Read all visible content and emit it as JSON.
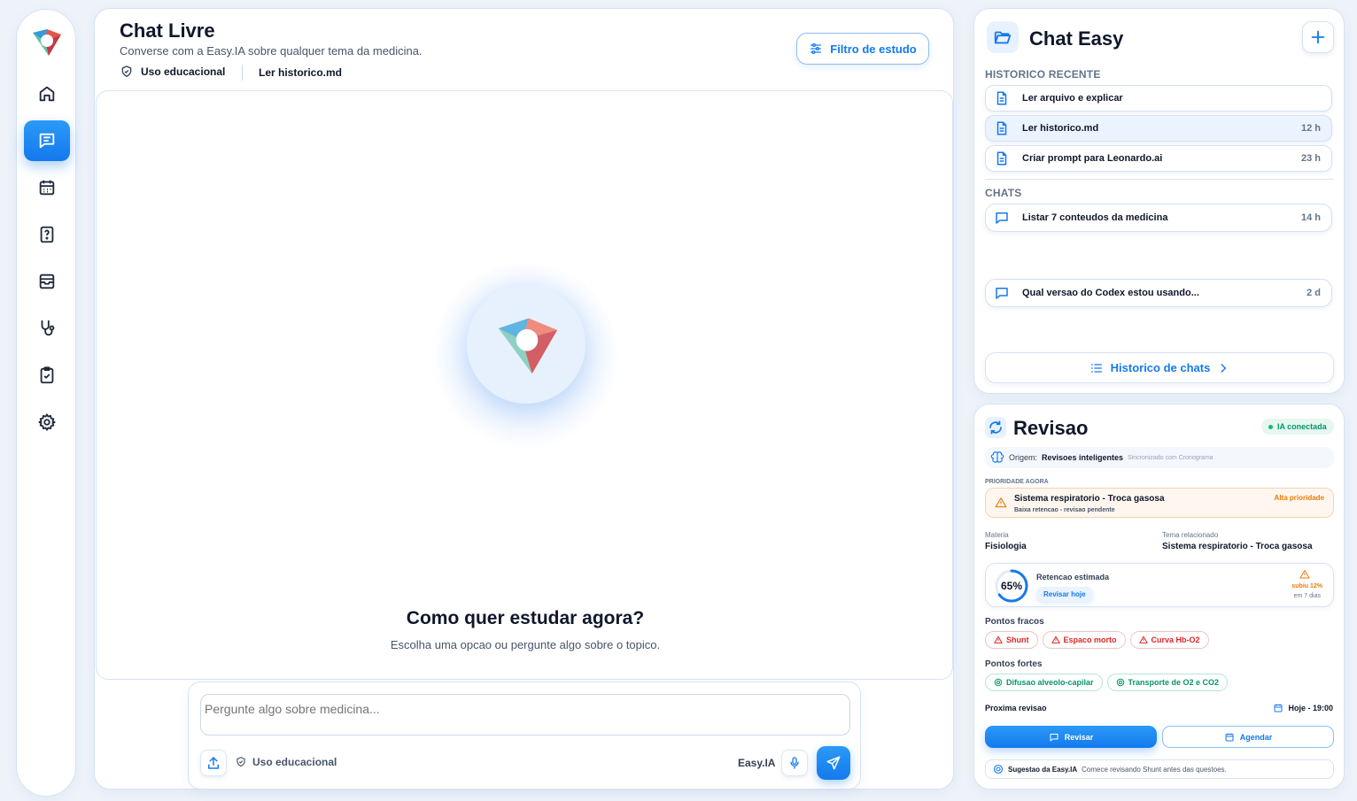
{
  "colors": {
    "accent": "#1479ee",
    "weak": "#dc2626",
    "strong": "#059669",
    "warning": "#ea7a0c"
  },
  "sidebar": {
    "items": [
      {
        "icon": "home-icon"
      },
      {
        "icon": "chat-icon",
        "active": true
      },
      {
        "icon": "calendar-icon"
      },
      {
        "icon": "question-icon"
      },
      {
        "icon": "archive-icon"
      },
      {
        "icon": "stethoscope-icon"
      },
      {
        "icon": "clipboard-check-icon"
      },
      {
        "icon": "gear-icon"
      }
    ]
  },
  "main": {
    "title": "Chat Livre",
    "subtitle": "Converse com a Easy.IA sobre qualquer tema da medicina.",
    "badge_educational": "Uso educacional",
    "badge_file": "Ler historico.md",
    "filter_button": "Filtro de estudo",
    "empty_title": "Como quer estudar agora?",
    "empty_subtitle": "Escolha uma opcao ou pergunte algo sobre o topico.",
    "input_placeholder": "Pergunte algo sobre medicina...",
    "input_badge": "Uso educacional",
    "model_label": "Easy.IA"
  },
  "chat_easy": {
    "title": "Chat Easy",
    "recent_label": "HISTORICO RECENTE",
    "recent": [
      {
        "label": "Ler arquivo e explicar",
        "time": ""
      },
      {
        "label": "Ler historico.md",
        "time": "12 h"
      },
      {
        "label": "Criar prompt para Leonardo.ai",
        "time": "23 h"
      }
    ],
    "chats_label": "CHATS",
    "chats": [
      {
        "label": "Listar 7 conteudos da medicina",
        "time": "14 h"
      },
      {
        "label": "Qual versao do Codex estou usando...",
        "time": "2 d"
      }
    ],
    "history_button": "Historico de chats"
  },
  "revisao": {
    "title": "Revisao",
    "status": "IA conectada",
    "origin_prefix": "Origem:",
    "origin_value": "Revisoes inteligentes",
    "origin_sync": "Sincronizado com Cronograma",
    "priority_label": "PRIORIDADE AGORA",
    "priority_title": "Sistema respiratorio - Troca gasosa",
    "priority_sub": "Baixa retencao - revisao pendente",
    "priority_badge": "Alta prioridade",
    "materia_label": "Materia",
    "materia_value": "Fisiologia",
    "tema_label": "Tema relacionado",
    "tema_value": "Sistema respiratorio - Troca gasosa",
    "retention_percent": 65,
    "retention_text": "65%",
    "retention_label": "Retencao estimada",
    "review_today": "Revisar hoje",
    "trend_up": "subiu 12%",
    "trend_period": "em 7 dias",
    "weak_label": "Pontos fracos",
    "weak": [
      "Shunt",
      "Espaco morto",
      "Curva Hb-O2"
    ],
    "strong_label": "Pontos fortes",
    "strong": [
      "Difusao alveolo-capilar",
      "Transporte de O2 e CO2"
    ],
    "next_label": "Proxima revisao",
    "next_value": "Hoje - 19:00",
    "btn_review": "Revisar",
    "btn_schedule": "Agendar",
    "suggestion_prefix": "Sugestao da Easy.IA",
    "suggestion_text": "Comece revisando Shunt antes das questoes."
  }
}
